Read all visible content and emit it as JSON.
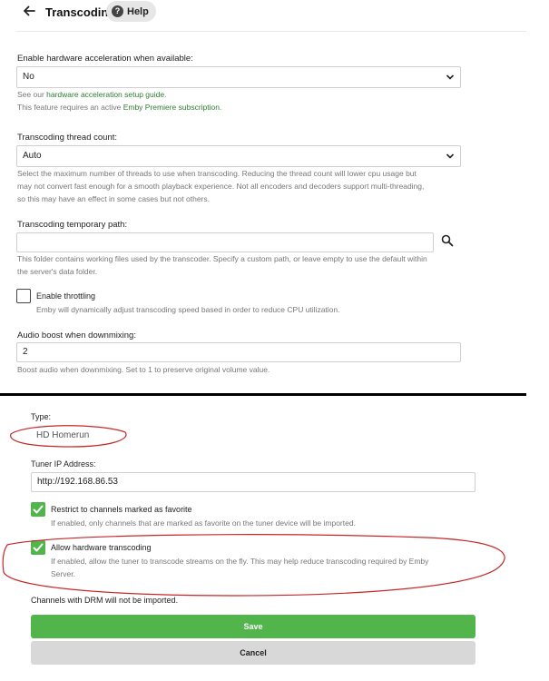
{
  "header": {
    "title": "Transcoding",
    "help_label": "Help",
    "back_icon": "arrow-left-icon",
    "help_icon": "question-circle-icon"
  },
  "hardware_accel": {
    "label": "Enable hardware acceleration when available:",
    "value": "No",
    "help_prefix": "See our ",
    "help_link": "hardware acceleration setup guide",
    "help_suffix": ".",
    "premiere_prefix": "This feature requires an active ",
    "premiere_link": "Emby Premiere subscription",
    "premiere_suffix": "."
  },
  "thread_count": {
    "label": "Transcoding thread count:",
    "value": "Auto",
    "help_line1": "Select the maximum number of threads to use when transcoding. Reducing the thread count will lower cpu usage but",
    "help_line2": "may not convert fast enough for a smooth playback experience. Not all encoders and decoders support multi-threading,",
    "help_line3": "so this may have an effect in some cases but not others."
  },
  "temp_path": {
    "label": "Transcoding temporary path:",
    "value": "",
    "help_line1": "This folder contains working files used by the transcoder. Specify a custom path, or leave empty to use the default within",
    "help_line2": "the server's data folder."
  },
  "throttling": {
    "label": "Enable throttling",
    "checked": false,
    "help": "Emby will dynamically adjust transcoding speed based in order to reduce CPU utilization."
  },
  "audio_boost": {
    "label": "Audio boost when downmixing:",
    "value": "2",
    "help": "Boost audio when downmixing. Set to 1 to preserve original volume value."
  },
  "tuner": {
    "type_label": "Type:",
    "type_value": "HD Homerun",
    "ip_label": "Tuner IP Address:",
    "ip_value": "http://192.168.86.53",
    "favorites": {
      "label": "Restrict to channels marked as favorite",
      "checked": true,
      "help": "If enabled, only channels that are marked as favorite on the tuner device will be imported."
    },
    "hw_transcoding": {
      "label": "Allow hardware transcoding",
      "checked": true,
      "help_line1": "If enabled, allow the tuner to transcode streams on the fly. This may help reduce transcoding required by Emby",
      "help_line2": "Server."
    },
    "drm_note": "Channels with DRM will not be imported."
  },
  "buttons": {
    "save": "Save",
    "cancel": "Cancel"
  },
  "colors": {
    "accent": "#52b54b",
    "link": "#2e7d32",
    "annotation": "#c62828"
  }
}
